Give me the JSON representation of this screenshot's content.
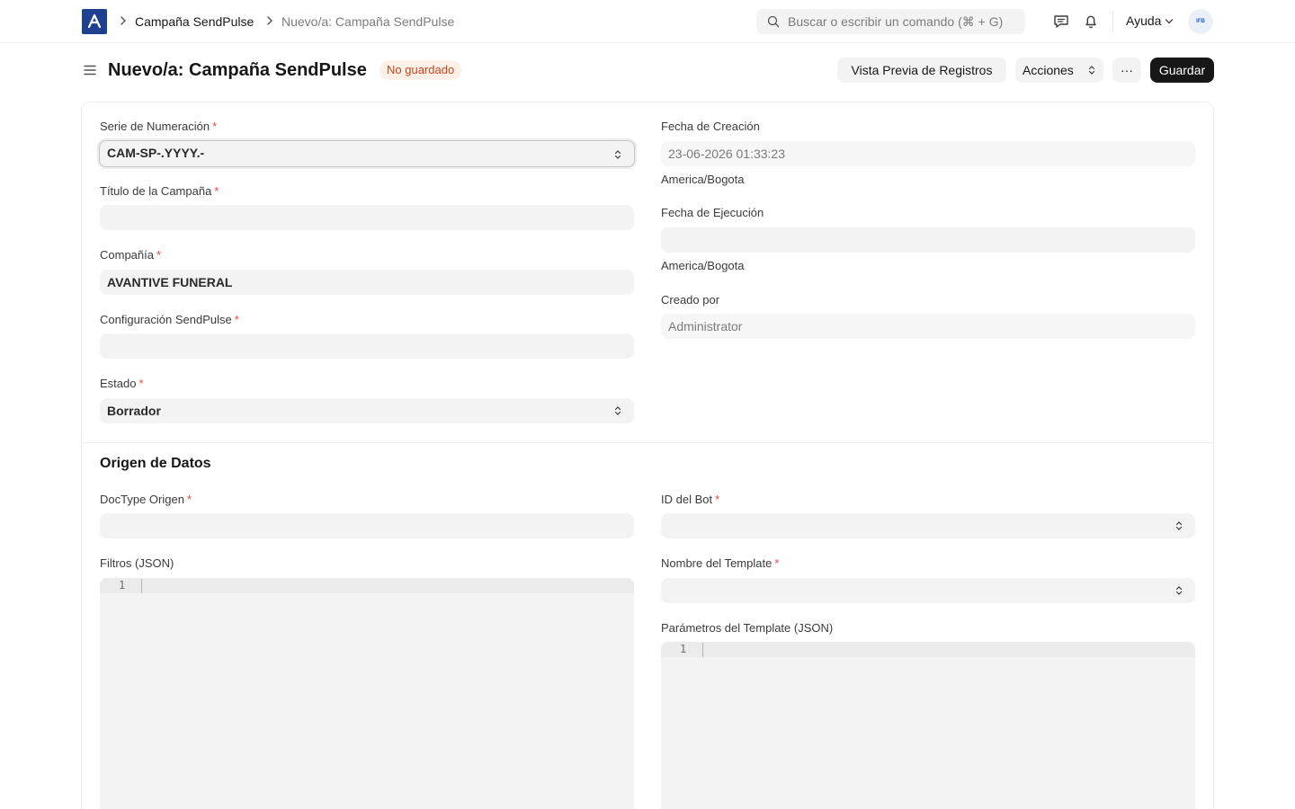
{
  "navbar": {
    "breadcrumbs": [
      "Campaña SendPulse",
      "Nuevo/a: Campaña SendPulse"
    ],
    "search_placeholder": "Buscar o escribir un comando (⌘ + G)",
    "help_label": "Ayuda",
    "avatar_text": "IFB"
  },
  "page": {
    "title": "Nuevo/a: Campaña SendPulse",
    "status": "No guardado",
    "preview_button": "Vista Previa de Registros",
    "actions_button": "Acciones",
    "more_button": "···",
    "save_button": "Guardar"
  },
  "form": {
    "naming_series": {
      "label": "Serie de Numeración",
      "value": "CAM-SP-.YYYY.-"
    },
    "campaign_title": {
      "label": "Título de la Campaña",
      "value": ""
    },
    "company": {
      "label": "Compañía",
      "value": "AVANTIVE FUNERAL"
    },
    "sendpulse_config": {
      "label": "Configuración SendPulse",
      "value": ""
    },
    "status": {
      "label": "Estado",
      "value": "Borrador"
    },
    "creation_date": {
      "label": "Fecha de Creación",
      "value": "23-06-2026 01:33:23",
      "timezone": "America/Bogota"
    },
    "execution_date": {
      "label": "Fecha de Ejecución",
      "value": "",
      "timezone": "America/Bogota"
    },
    "created_by": {
      "label": "Creado por",
      "value": "Administrator"
    }
  },
  "data_source": {
    "title": "Origen de Datos",
    "doctype": {
      "label": "DocType Origen",
      "value": ""
    },
    "filters": {
      "label": "Filtros (JSON)",
      "line_number": "1"
    },
    "bot_id": {
      "label": "ID del Bot",
      "value": ""
    },
    "template_name": {
      "label": "Nombre del Template",
      "value": ""
    },
    "template_params": {
      "label": "Parámetros del Template (JSON)",
      "line_number": "1"
    }
  },
  "colors": {
    "logo": "#1f3f8f",
    "status_bg": "#fff1e7",
    "status_text": "#c7461c",
    "required": "#e5484d",
    "primary_button": "#171717"
  },
  "icons": [
    "app-logo",
    "chevron-right-icon",
    "search-icon",
    "comment-icon",
    "bell-icon",
    "chevron-down-icon",
    "hamburger-icon",
    "select-chevron-icon"
  ]
}
